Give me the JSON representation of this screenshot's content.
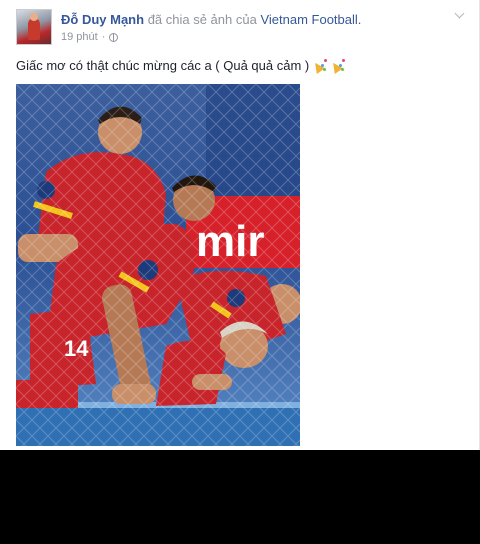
{
  "post": {
    "author": "Đỗ Duy Mạnh",
    "action": "đã chia sẻ ảnh của",
    "shared_page": "Vietnam Football.",
    "time": "19 phút",
    "separator": "·",
    "privacy_icon": "globe-icon",
    "options_icon": "chevron-down-icon",
    "caption": "Giấc mơ có thật chúc mừng các a ( Quả quả cảm )",
    "emoji_icon": "party-popper-icon"
  },
  "photo": {
    "jersey_number": "14",
    "banner_text": "mir"
  },
  "colors": {
    "link": "#365899",
    "meta": "#90949c",
    "jersey_red": "#c8242b",
    "court_blue": "#2f6fb4"
  }
}
